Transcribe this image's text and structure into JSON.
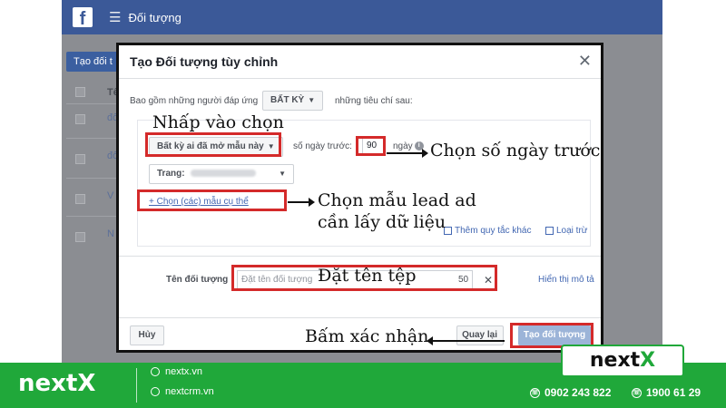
{
  "app": {
    "logo": "f",
    "page_title": "Đối tượng",
    "create_button": "Tạo đối t"
  },
  "bg_table": {
    "header": "Tê",
    "rows": [
      "đố",
      "đố",
      "V",
      "N"
    ]
  },
  "modal": {
    "title": "Tạo Đối tượng tùy chỉnh",
    "include_label": "Bao gồm những người đáp ứng",
    "include_value": "BẤT KỲ",
    "include_after": "những tiêu chí sau:",
    "interaction_value": "Bất kỳ ai đã mở mẫu này",
    "days_label": "số ngày trước:",
    "days_value": "90",
    "days_unit": "ngày",
    "page_label": "Trang:",
    "choose_forms": "+ Chọn (các) mẫu cụ thể",
    "add_rule": "Thêm quy tắc khác",
    "exclude": "Loại trừ",
    "name_label": "Tên đối tượng",
    "name_placeholder": "Đặt tên đối tượng",
    "name_count": "50",
    "show_description": "Hiển thị mô tả",
    "cancel": "Hủy",
    "back": "Quay lại",
    "create": "Tạo đối tượng"
  },
  "annotations": {
    "click_select": "Nhấp vào chọn",
    "choose_days": "Chọn số ngày trước",
    "choose_form_line1": "Chọn mẫu lead ad",
    "choose_form_line2": "cần lấy dữ liệu",
    "name_file": "Đặt tên tệp",
    "confirm": "Bấm xác nhận"
  },
  "brand": {
    "name_plain": "next",
    "name_x": "X",
    "website1": "nextx.vn",
    "website2": "nextcrm.vn",
    "phone1": "0902 243 822",
    "phone2": "1900 61 29"
  },
  "colors": {
    "fb_blue": "#3b5998",
    "highlight": "#d42a2a",
    "brand_green": "#20a83a"
  },
  "icons": [
    "facebook-logo-icon",
    "hamburger-icon",
    "close-icon",
    "info-icon",
    "globe-icon",
    "phone-icon"
  ]
}
